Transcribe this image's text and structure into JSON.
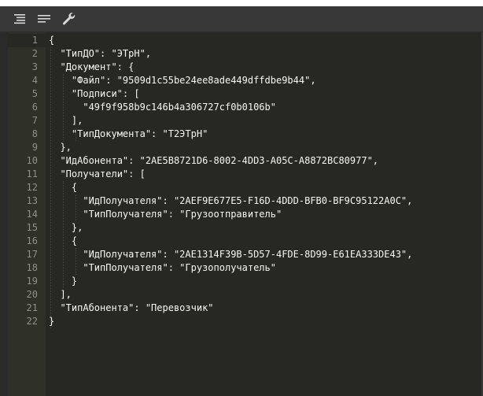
{
  "toolbar": {
    "buttons": [
      {
        "name": "format-button",
        "icon": "format-icon"
      },
      {
        "name": "compact-button",
        "icon": "compact-icon"
      },
      {
        "name": "repair-button",
        "icon": "wrench-icon"
      }
    ]
  },
  "editor": {
    "colors": {
      "background": "#272822",
      "gutter": "#2f3129",
      "text": "#f8f8f2",
      "line_number": "#8f908a"
    },
    "lines": [
      "{",
      "  \"ТипДО\": \"ЭТрН\",",
      "  \"Документ\": {",
      "    \"Файл\": \"9509d1c55be24ee8ade449dffdbe9b44\",",
      "    \"Подписи\": [",
      "      \"49f9f958b9c146b4a306727cf0b0106b\"",
      "    ],",
      "    \"ТипДокумента\": \"Т2ЭТрН\"",
      "  },",
      "  \"ИдАбонента\": \"2AE5B8721D6-8002-4DD3-A05C-A8872BC80977\",",
      "  \"Получатели\": [",
      "    {",
      "      \"ИдПолучателя\": \"2AEF9E677E5-F16D-4DDD-BFB0-BF9C95122A0C\",",
      "      \"ТипПолучателя\": \"Грузоотправитель\"",
      "    },",
      "    {",
      "      \"ИдПолучателя\": \"2AE1314F39B-5D57-4FDE-8D99-E61EA333DE43\",",
      "      \"ТипПолучателя\": \"Грузополучатель\"",
      "    }",
      "  ],",
      "  \"ТипАбонента\": \"Перевозчик\"",
      "}"
    ],
    "line_numbers": [
      "1",
      "2",
      "3",
      "4",
      "5",
      "6",
      "7",
      "8",
      "9",
      "10",
      "11",
      "12",
      "13",
      "14",
      "15",
      "16",
      "17",
      "18",
      "19",
      "20",
      "21",
      "22"
    ]
  }
}
